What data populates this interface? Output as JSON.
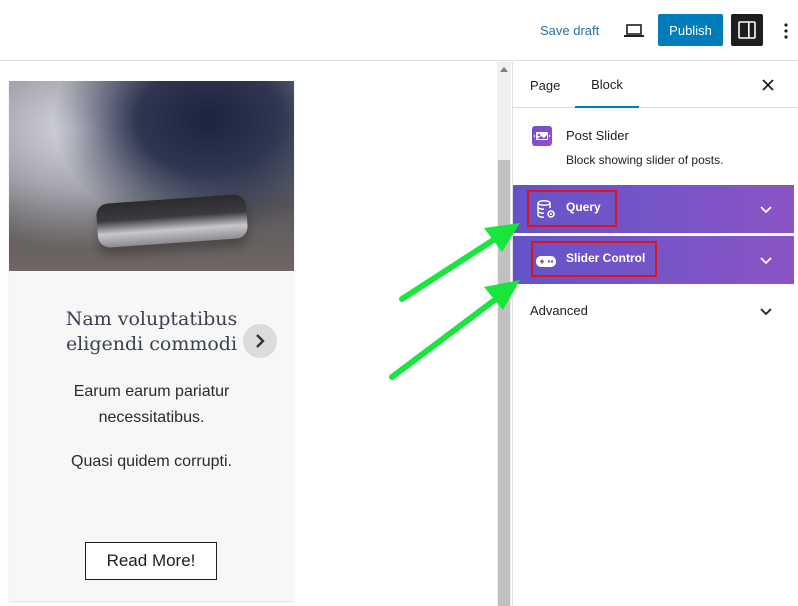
{
  "topbar": {
    "save_draft_label": "Save draft",
    "publish_label": "Publish",
    "accent_color": "#007cba"
  },
  "post": {
    "title": "Nam voluptatibus eligendi commodi",
    "excerpt_lines": [
      "Earum earum pariatur necessitatibus.",
      "Quasi quidem corrupti."
    ],
    "read_more_label": "Read More!"
  },
  "sidebar": {
    "tabs": [
      {
        "label": "Page"
      },
      {
        "label": "Block"
      }
    ],
    "active_tab": "Block",
    "block": {
      "name": "Post Slider",
      "description": "Block showing slider of posts.",
      "icon": "post-slider-icon"
    },
    "panels": [
      {
        "label": "Query",
        "icon": "database-gear-icon"
      },
      {
        "label": "Slider Control",
        "icon": "gamepad-icon"
      }
    ],
    "advanced_label": "Advanced",
    "panel_gradient": [
      "#6453c8",
      "#8b53c4"
    ]
  },
  "annotations": {
    "highlight_color": "#e0131b",
    "arrow_color": "#19e63d"
  }
}
